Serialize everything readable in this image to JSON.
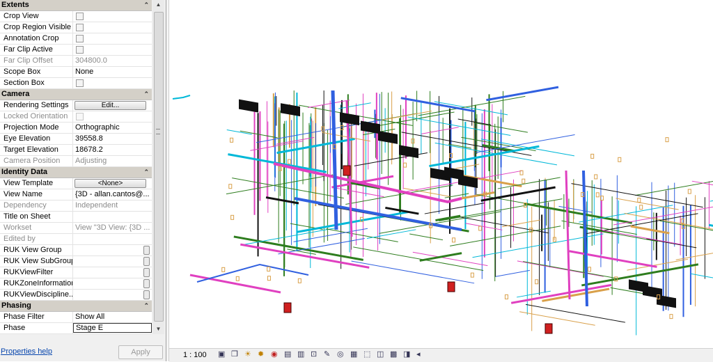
{
  "properties": {
    "groups": [
      {
        "title": "Extents",
        "rows": [
          {
            "name": "Crop View",
            "type": "checkbox",
            "disabled": false
          },
          {
            "name": "Crop Region Visible",
            "type": "checkbox",
            "disabled": false
          },
          {
            "name": "Annotation Crop",
            "type": "checkbox",
            "disabled": false
          },
          {
            "name": "Far Clip Active",
            "type": "checkbox",
            "disabled": false
          },
          {
            "name": "Far Clip Offset",
            "type": "text",
            "value": "304800.0",
            "disabled": true
          },
          {
            "name": "Scope Box",
            "type": "text",
            "value": "None",
            "disabled": false
          },
          {
            "name": "Section Box",
            "type": "checkbox",
            "disabled": false
          }
        ]
      },
      {
        "title": "Camera",
        "rows": [
          {
            "name": "Rendering Settings",
            "type": "button",
            "value": "Edit...",
            "disabled": false
          },
          {
            "name": "Locked Orientation",
            "type": "checkbox",
            "disabled": true
          },
          {
            "name": "Projection Mode",
            "type": "text",
            "value": "Orthographic",
            "disabled": false
          },
          {
            "name": "Eye Elevation",
            "type": "text",
            "value": "39558.8",
            "disabled": false
          },
          {
            "name": "Target Elevation",
            "type": "text",
            "value": "18678.2",
            "disabled": false
          },
          {
            "name": "Camera Position",
            "type": "text",
            "value": "Adjusting",
            "disabled": true
          }
        ]
      },
      {
        "title": "Identity Data",
        "rows": [
          {
            "name": "View Template",
            "type": "button",
            "value": "<None>",
            "disabled": false
          },
          {
            "name": "View Name",
            "type": "text",
            "value": "{3D - allan.cantos@...",
            "disabled": false
          },
          {
            "name": "Dependency",
            "type": "text",
            "value": "Independent",
            "disabled": true
          },
          {
            "name": "Title on Sheet",
            "type": "text",
            "value": "",
            "disabled": false
          },
          {
            "name": "Workset",
            "type": "text",
            "value": "View \"3D View: {3D ...",
            "disabled": true
          },
          {
            "name": "Edited by",
            "type": "text",
            "value": "",
            "disabled": true
          },
          {
            "name": "RUK View Group",
            "type": "dots",
            "value": "",
            "disabled": false
          },
          {
            "name": "RUK View SubGroup",
            "type": "dots",
            "value": "",
            "disabled": false
          },
          {
            "name": "RUKViewFilter",
            "type": "dots",
            "value": "",
            "disabled": false
          },
          {
            "name": "RUKZoneInformation",
            "type": "dots",
            "value": "",
            "disabled": false
          },
          {
            "name": "RUKViewDiscipline...",
            "type": "dots",
            "value": "",
            "disabled": false
          }
        ]
      },
      {
        "title": "Phasing",
        "rows": [
          {
            "name": "Phase Filter",
            "type": "text",
            "value": "Show All",
            "disabled": false
          },
          {
            "name": "Phase",
            "type": "selected",
            "value": "Stage E",
            "disabled": false
          }
        ]
      }
    ],
    "help_link": "Properties help",
    "apply_label": "Apply"
  },
  "status_bar": {
    "scale": "1 : 100",
    "tools": [
      "detail-level-icon",
      "visual-style-icon",
      "sun-path-icon",
      "shadows-icon",
      "render-icon",
      "crop-view-icon",
      "show-crop-icon",
      "unlock-3d-icon",
      "temporary-hide-icon",
      "reveal-hidden-icon",
      "temporary-view-properties-icon",
      "worksharing-icon",
      "analytical-model-icon",
      "highlight-displacement-icon",
      "reveal-constraints-icon",
      "scroll-left-icon"
    ]
  },
  "colors": {
    "pipe_green": "#2e7d1e",
    "pipe_orange": "#d9a04a",
    "pipe_magenta": "#e040c0",
    "duct_blue": "#3060e0",
    "structure_black": "#111111",
    "cyan": "#00b8d8",
    "red": "#d02020"
  }
}
